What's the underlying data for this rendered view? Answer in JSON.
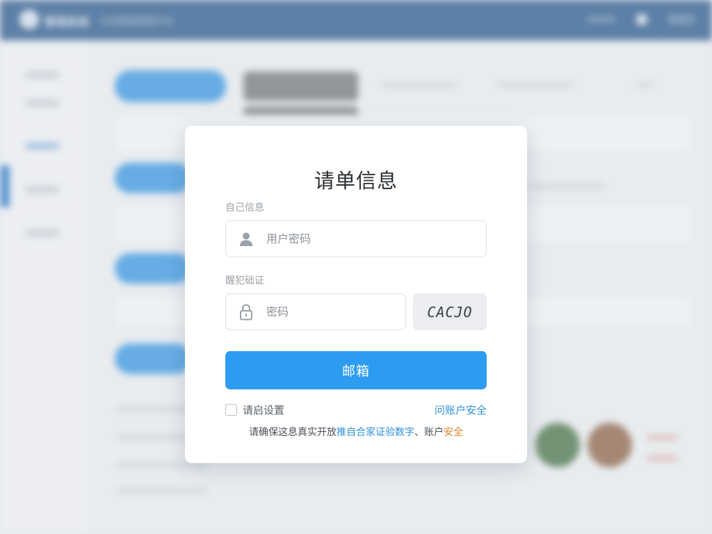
{
  "background": {
    "app_name": "管理系统",
    "header_subtitle": "在线数据管理平台",
    "header_right": [
      "帮助",
      "管理员"
    ],
    "sidebar_items": [
      "首页概览",
      "数据管理",
      "用户列表",
      "系统设置",
      "退出"
    ]
  },
  "modal": {
    "title": "请单信息",
    "username_label": "自己信息",
    "username_placeholder": "用户密码",
    "password_label": "醒犯础证",
    "password_placeholder": "密码",
    "captcha_text": "CACJO",
    "submit_label": "邮箱",
    "remember_label": "请启设置",
    "account_link": "问账户安全",
    "notice_prefix": "请确保这息真实开放",
    "notice_blue": "推自合家证验数字",
    "notice_mid": "、账户",
    "notice_orange": "安全"
  },
  "icons": {
    "user": "user-icon",
    "lock": "lock-icon"
  },
  "colors": {
    "primary": "#2d9cf0",
    "header": "#1d4f86",
    "link": "#2d8fd9",
    "accent_orange": "#e0832a"
  }
}
